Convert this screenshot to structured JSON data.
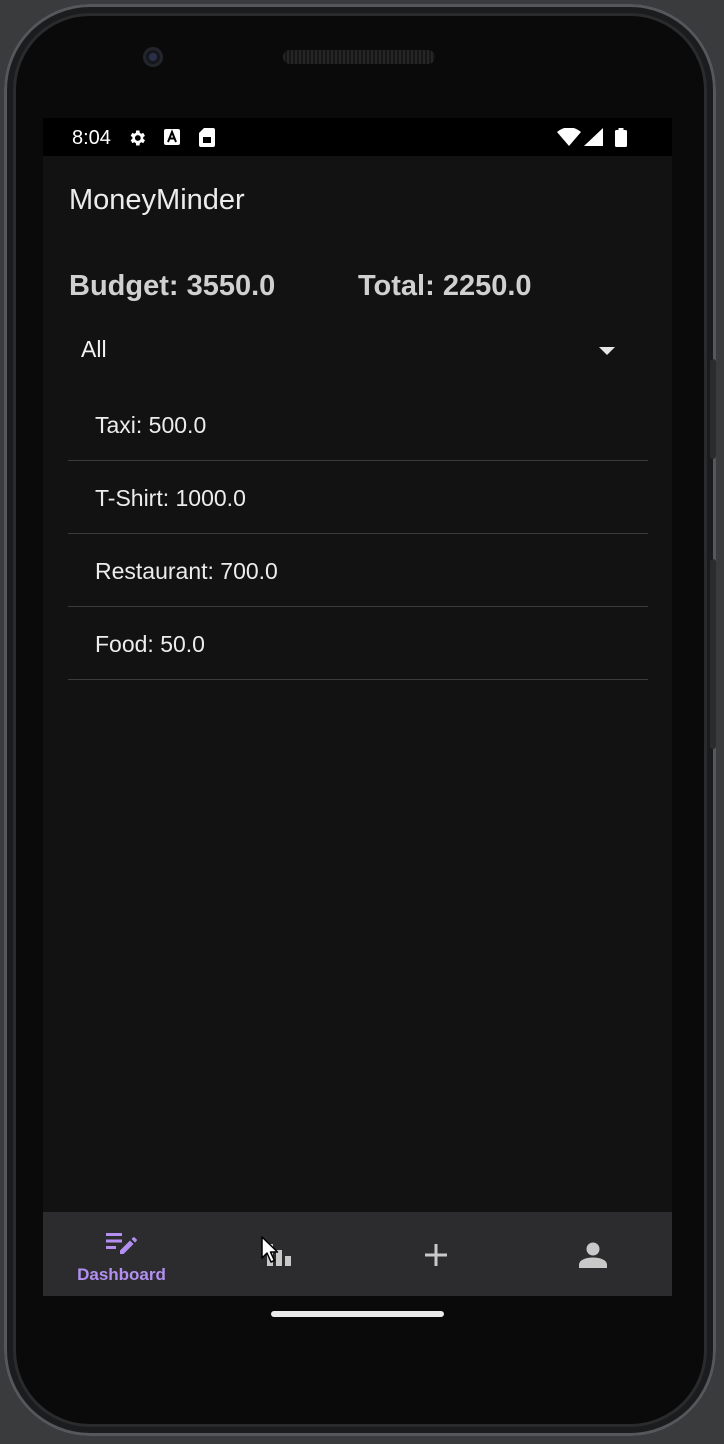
{
  "status_bar": {
    "time": "8:04",
    "left_icons": [
      "gear-icon",
      "font-a-icon",
      "sim-card-icon"
    ],
    "right_icons": [
      "wifi-icon",
      "cellular-signal-icon",
      "battery-icon"
    ]
  },
  "app": {
    "title": "MoneyMinder"
  },
  "summary": {
    "budget": "Budget: 3550.0",
    "total": "Total: 2250.0"
  },
  "filter": {
    "selected": "All"
  },
  "expenses": [
    {
      "label": "Taxi: 500.0"
    },
    {
      "label": "T-Shirt: 1000.0"
    },
    {
      "label": "Restaurant: 700.0"
    },
    {
      "label": "Food: 50.0"
    }
  ],
  "bottom_nav": {
    "items": [
      {
        "label": "Dashboard",
        "icon": "dashboard-edit-icon",
        "active": true
      },
      {
        "label": "",
        "icon": "bar-chart-icon",
        "active": false
      },
      {
        "label": "",
        "icon": "add-icon",
        "active": false
      },
      {
        "label": "",
        "icon": "person-icon",
        "active": false
      }
    ]
  },
  "colors": {
    "background": "#121212",
    "accent": "#b28ff0",
    "nav_background": "#2c2c2e",
    "text": "#ececec"
  }
}
